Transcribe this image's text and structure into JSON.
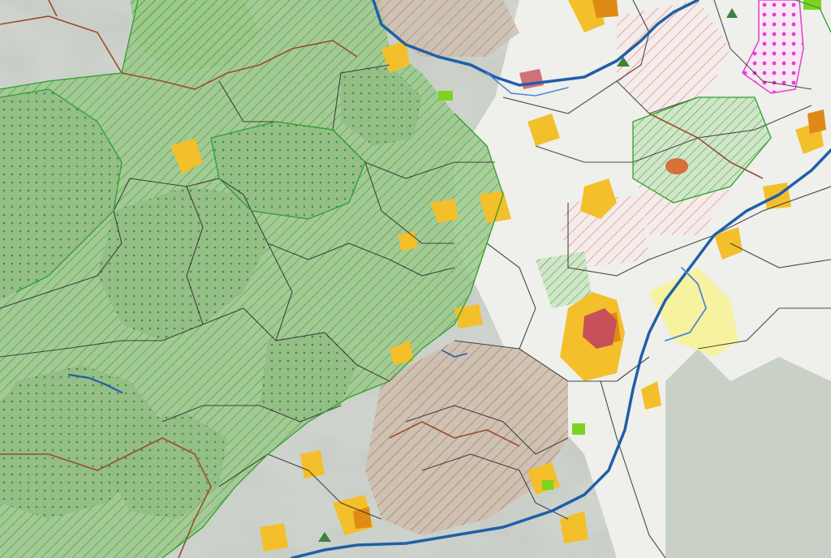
{
  "map": {
    "colors": {
      "relief": "#c9cfc7",
      "relief_light": "#e6e6e2",
      "forest_fill": "#8fbf7f",
      "forest_hatch": "#3d9c3d",
      "forest_dot": "#2f8f2f",
      "settlement_yellow": "#f3bf2a",
      "settlement_dark": "#e08a16",
      "urban_red": "#c8505a",
      "brownhatch": "#b0776a",
      "municipal_border": "#2c2c2c",
      "district_border": "#9c4b2a",
      "protected_border": "#2ca02c",
      "river": "#1f5fa8",
      "river_light": "#4d88d0",
      "magenta": "#e83ed0",
      "pale_yellow": "#f6f2a0",
      "bright_green": "#7ed321"
    },
    "layers": [
      "hillshade-relief",
      "forest-hatched",
      "forest-dotted",
      "agricultural-brown-hatch",
      "settlements",
      "urban-core",
      "rivers",
      "municipal-borders",
      "district-borders",
      "protected-area-borders",
      "magenta-dotted-zone"
    ]
  }
}
